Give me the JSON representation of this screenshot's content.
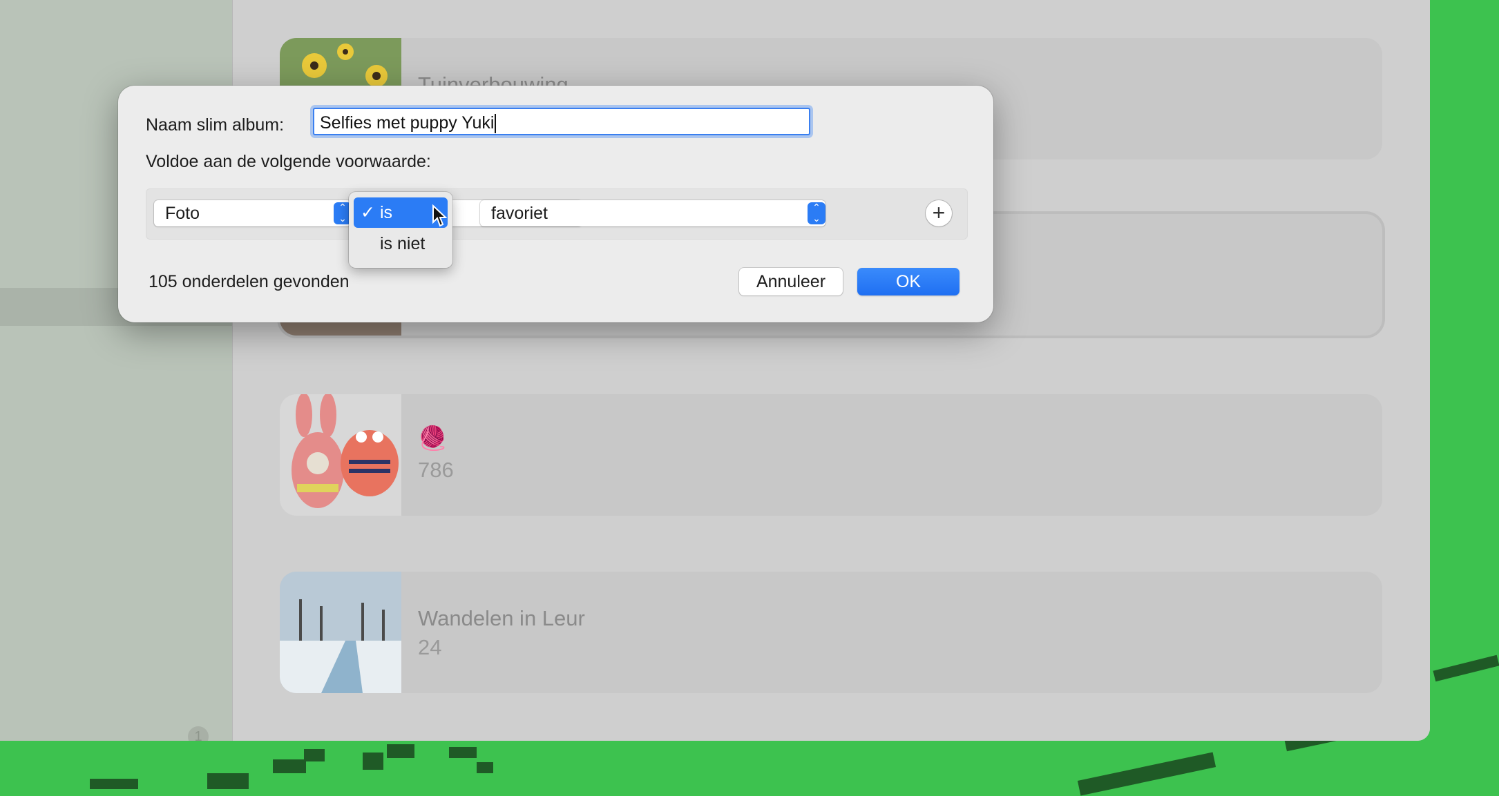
{
  "dialog": {
    "name_label": "Naam slim album:",
    "name_value": "Selfies met puppy Yuki",
    "condition_label": "Voldoe aan de volgende voorwaarde:",
    "field_select": "Foto",
    "operator_menu": {
      "items": [
        "is",
        "is niet"
      ],
      "checkmark": "✓"
    },
    "value_select": "favoriet",
    "add_condition": "+",
    "found_text": "105 onderdelen gevonden",
    "cancel_label": "Annuleer",
    "ok_label": "OK"
  },
  "albums": [
    {
      "title": "Tuinverbouwing",
      "count": ""
    },
    {
      "title": "",
      "count": ""
    },
    {
      "title": "🧶",
      "count": "786"
    },
    {
      "title": "Wandelen in Leur",
      "count": "24"
    }
  ],
  "sidebar": {
    "badge": "1"
  },
  "colors": {
    "accent": "#2b7cf5",
    "desktop": "#3dc24f"
  }
}
